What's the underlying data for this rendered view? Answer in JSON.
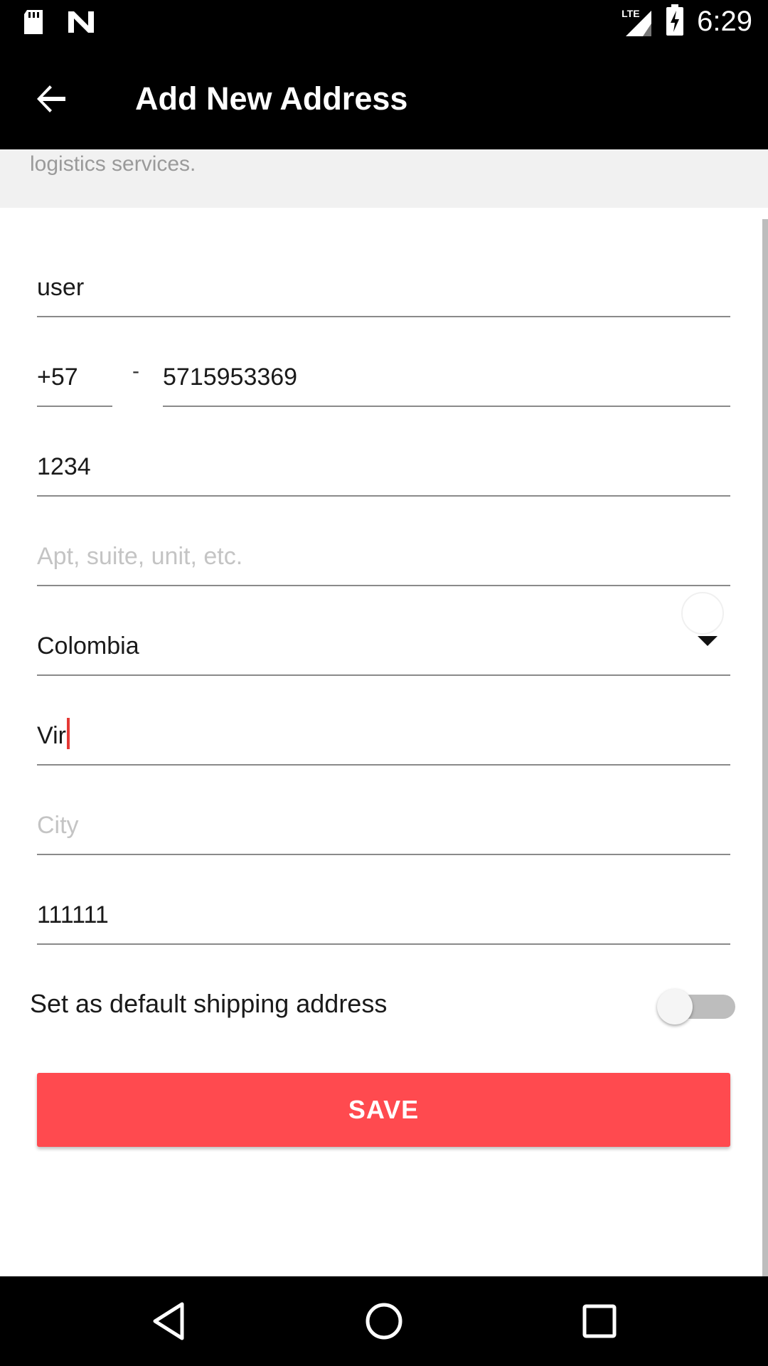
{
  "status_bar": {
    "time": "6:29",
    "network_label": "LTE",
    "icons": [
      "sd-card-icon",
      "n-notification-icon",
      "lte-signal-icon",
      "battery-charging-icon"
    ]
  },
  "app_bar": {
    "title": "Add New Address",
    "back_icon": "arrow-back-icon"
  },
  "notice": {
    "text": "logistics services."
  },
  "form": {
    "name_value": "user",
    "phone_code": "+57",
    "phone_separator": "-",
    "phone_number": "5715953369",
    "street_value": "1234",
    "apt_placeholder": "Apt, suite, unit, etc.",
    "country_value": "Colombia",
    "state_value": "Vir",
    "city_placeholder": "City",
    "zip_value": "111111"
  },
  "default_toggle": {
    "label": "Set as default shipping address",
    "checked": false
  },
  "save_button": {
    "label": "SAVE"
  },
  "colors": {
    "accent": "#ff4a4f",
    "cursor": "#e53935",
    "bar_background": "#000000"
  },
  "nav_bar": {
    "icons": [
      "nav-back-icon",
      "nav-home-icon",
      "nav-recents-icon"
    ]
  }
}
